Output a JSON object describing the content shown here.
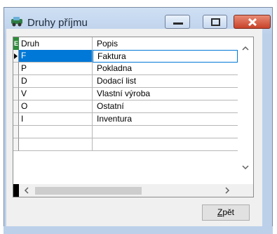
{
  "window": {
    "title": "Druhy příjmu"
  },
  "grid": {
    "columns": [
      "Druh",
      "Popis"
    ],
    "rows": [
      {
        "druh": "F",
        "popis": "Faktura"
      },
      {
        "druh": "P",
        "popis": "Pokladna"
      },
      {
        "druh": "D",
        "popis": "Dodací list"
      },
      {
        "druh": "V",
        "popis": "Vlastní výroba"
      },
      {
        "druh": "O",
        "popis": "Ostatní"
      },
      {
        "druh": "I",
        "popis": "Inventura"
      },
      {
        "druh": "",
        "popis": ""
      },
      {
        "druh": "",
        "popis": ""
      }
    ],
    "selected_row": 0,
    "corner_label": "E"
  },
  "buttons": {
    "back_label_underlined": "Z",
    "back_label_rest": "pět"
  },
  "icons": {
    "app": "car-icon",
    "minimize": "minimize-icon",
    "maximize": "maximize-icon",
    "close": "close-icon"
  },
  "colors": {
    "selection": "#0078d7",
    "close_button": "#c8432b"
  }
}
